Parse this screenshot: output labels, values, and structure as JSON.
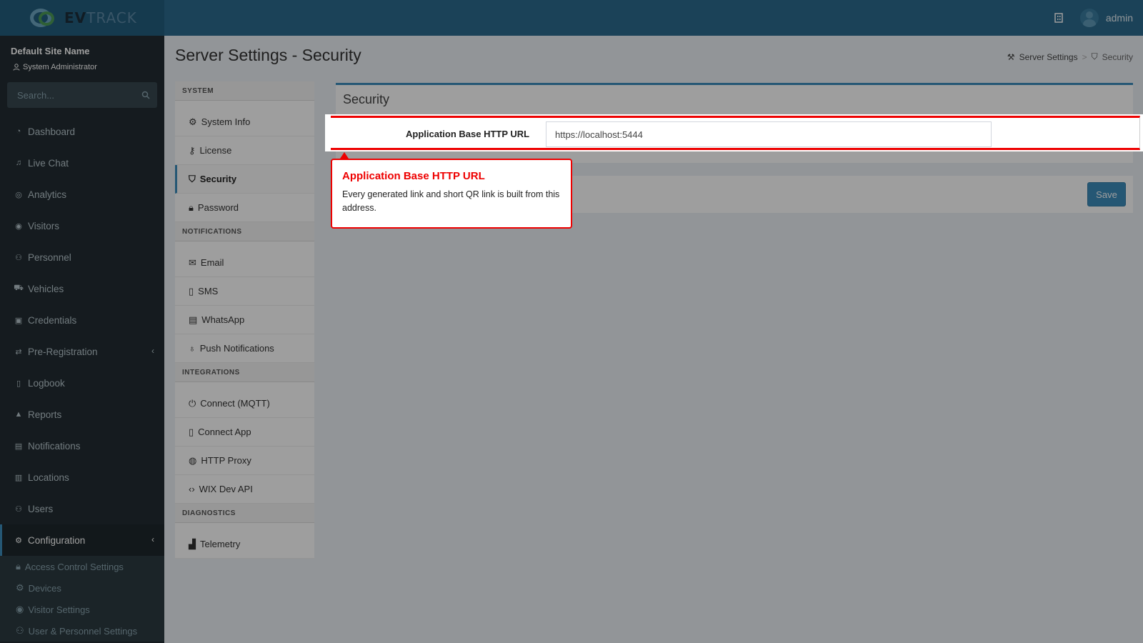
{
  "header": {
    "logo_text_ev": "EV",
    "logo_text_track": "TRACK",
    "username": "admin"
  },
  "sidebar": {
    "site_name": "Default Site Name",
    "role": "System Administrator",
    "search_placeholder": "Search...",
    "items": [
      {
        "label": "Dashboard",
        "icon": "dashboard-icon"
      },
      {
        "label": "Live Chat",
        "icon": "headset-icon"
      },
      {
        "label": "Analytics",
        "icon": "target-icon"
      },
      {
        "label": "Visitors",
        "icon": "eye-icon"
      },
      {
        "label": "Personnel",
        "icon": "people-icon"
      },
      {
        "label": "Vehicles",
        "icon": "car-icon"
      },
      {
        "label": "Credentials",
        "icon": "id-card-icon"
      },
      {
        "label": "Pre-Registration",
        "icon": "arrows-icon"
      },
      {
        "label": "Logbook",
        "icon": "book-icon"
      },
      {
        "label": "Reports",
        "icon": "chart-icon"
      },
      {
        "label": "Notifications",
        "icon": "messages-icon"
      },
      {
        "label": "Locations",
        "icon": "map-icon"
      },
      {
        "label": "Users",
        "icon": "users-icon"
      },
      {
        "label": "Configuration",
        "icon": "gear-icon"
      }
    ],
    "submenu": [
      {
        "label": "Access Control Settings",
        "icon": "lock-icon"
      },
      {
        "label": "Devices",
        "icon": "gear-icon"
      },
      {
        "label": "Visitor Settings",
        "icon": "eye-icon"
      },
      {
        "label": "User & Personnel Settings",
        "icon": "users-icon"
      }
    ]
  },
  "page": {
    "title": "Server Settings - Security",
    "breadcrumb_parent": "Server Settings",
    "breadcrumb_current": "Security"
  },
  "settings_nav": {
    "system_header": "SYSTEM",
    "system_items": [
      "System Info",
      "License",
      "Security",
      "Password"
    ],
    "notifications_header": "NOTIFICATIONS",
    "notifications_items": [
      "Email",
      "SMS",
      "WhatsApp",
      "Push Notifications"
    ],
    "integrations_header": "INTEGRATIONS",
    "integrations_items": [
      "Connect (MQTT)",
      "Connect App",
      "HTTP Proxy",
      "WIX Dev API"
    ],
    "diagnostics_header": "DIAGNOSTICS",
    "diagnostics_items": [
      "Telemetry"
    ]
  },
  "panel": {
    "title": "Security",
    "field_label": "Application Base HTTP URL",
    "field_value": "https://localhost:5444",
    "save_label": "Save"
  },
  "tooltip": {
    "title": "Application Base HTTP URL",
    "body": "Every generated link and short QR link is built from this address."
  },
  "colors": {
    "header": "#2c6b8e",
    "sidebar": "#222d32",
    "accent": "#3c8dbc",
    "highlight": "#e00000"
  }
}
